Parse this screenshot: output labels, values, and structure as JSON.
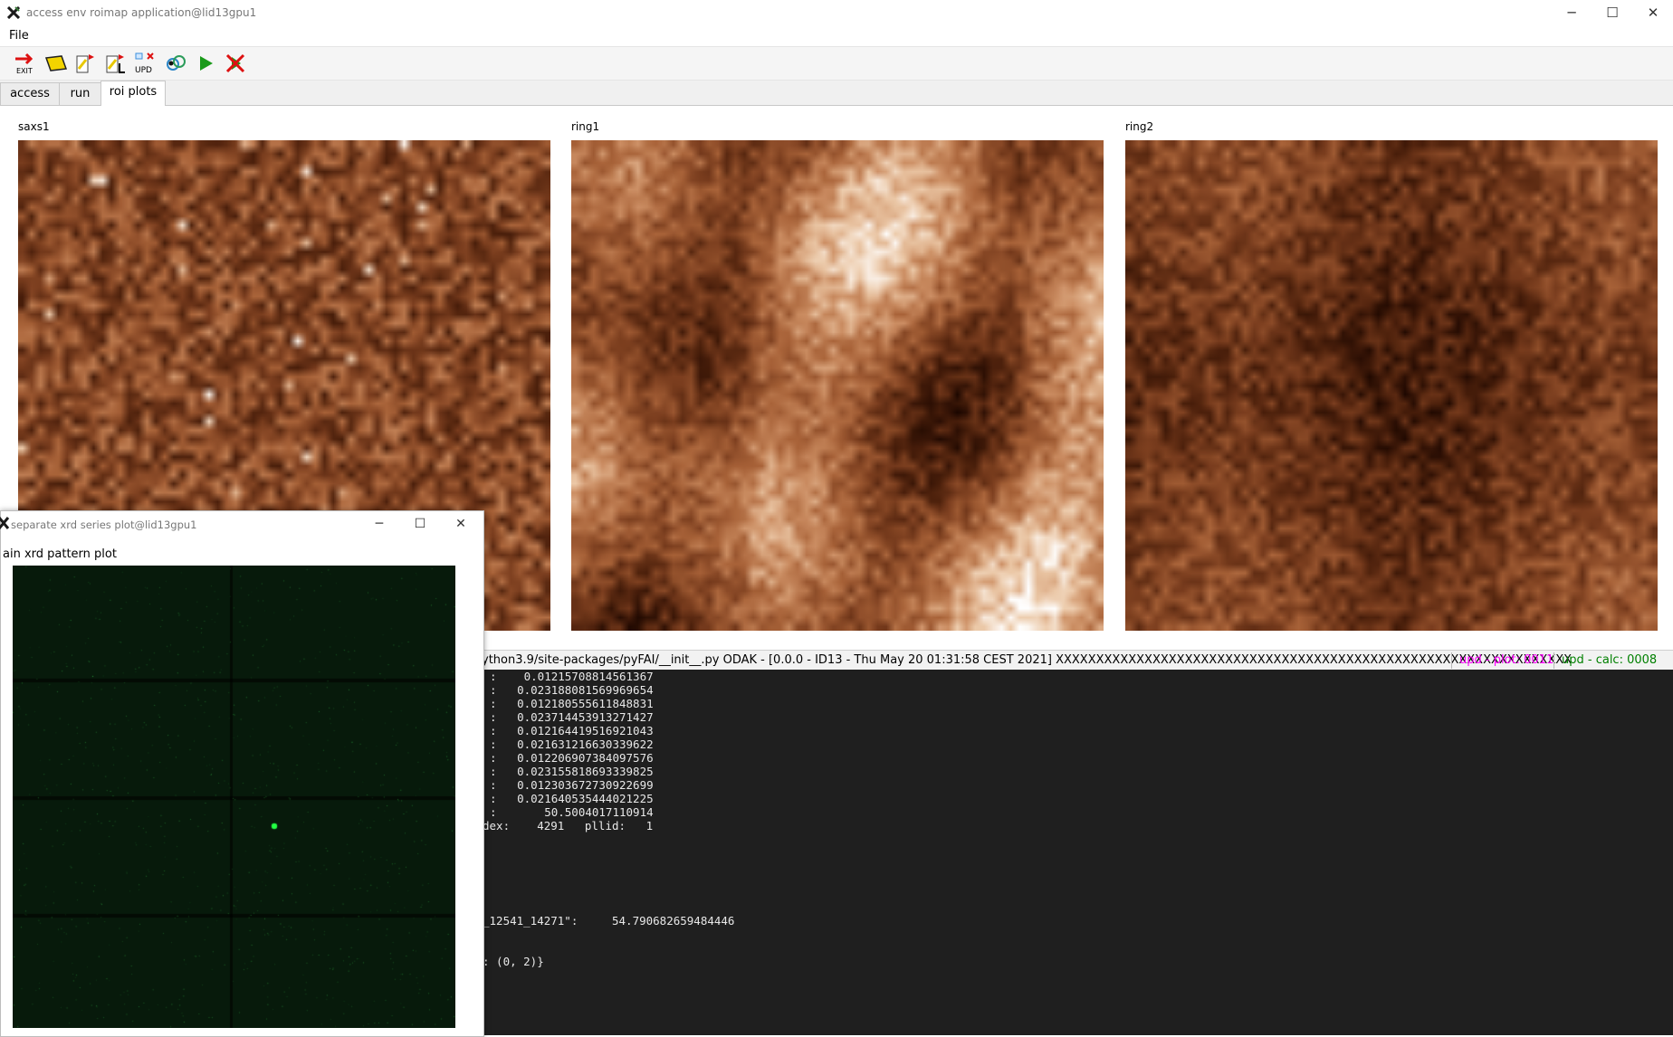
{
  "window": {
    "title": "access env roimap application@lid13gpu1",
    "app_icon": "x-app-icon",
    "minimize": "─",
    "maximize": "☐",
    "close": "✕"
  },
  "menu": {
    "items": [
      "File"
    ]
  },
  "toolbar": {
    "buttons": [
      {
        "name": "exit-icon",
        "label": "EXIT"
      },
      {
        "name": "open-folder-icon",
        "label": ""
      },
      {
        "name": "load-r-icon",
        "label": ""
      },
      {
        "name": "load-l-icon",
        "label": ""
      },
      {
        "name": "update-icon",
        "label": "UPD"
      },
      {
        "name": "refresh-icon",
        "label": ""
      },
      {
        "name": "run-icon",
        "label": ""
      },
      {
        "name": "stop-icon",
        "label": ""
      }
    ]
  },
  "tabs": [
    {
      "label": "access",
      "active": false
    },
    {
      "label": "run",
      "active": false
    },
    {
      "label": "roi plots",
      "active": true
    }
  ],
  "plots": [
    {
      "label": "saxs1"
    },
    {
      "label": "ring1"
    },
    {
      "label": "ring2"
    }
  ],
  "statusbar": {
    "message": "ython3.9/site-packages/pyFAI/__init__.py  ODAK - [0.0.0 - ID13 - Thu May 20 01:31:58 CEST 2021] XXXXXXXXXXXXXXXXXXXXXXXXXXXXXXXXXXXXXXXXXXXXXXXXXXXXXXXXXXXXXXXX",
    "plot_status": "upd - plot: 0011",
    "calc_status": "upd - calc: 0008"
  },
  "console": {
    "lines": [
      ":    0.01215708814561367",
      ":   0.023188081569969654",
      ":   0.012180555611848831",
      ":   0.023714453913271427",
      ":   0.012164419516921043",
      ":   0.021631216630339622",
      ":   0.012206907384097576",
      ":   0.023155818693339825",
      ":   0.012303672730922699",
      ":   0.021640535444021225",
      ":       50.5004017110914",
      "dex:    4291   pllid:   1",
      "",
      "",
      "",
      "",
      "",
      "_12541_14271\":     54.790682659484446",
      "",
      "",
      ": (0, 2)}"
    ]
  },
  "overlay": {
    "title": "separate xrd series plot@lid13gpu1",
    "plot_label": "ain xrd pattern plot",
    "minimize": "─",
    "maximize": "☐",
    "close": "✕"
  },
  "colors": {
    "roi_colormap": [
      "#1a0600",
      "#4a1f0b",
      "#7a3d1e",
      "#a86238",
      "#cc8e63",
      "#ecc9a8",
      "#ffffff"
    ],
    "xrd_background": "#071a0b",
    "xrd_spot": "#22ff44",
    "status_plot": "#ff00ff",
    "status_calc": "#008000",
    "console_bg": "#1f1f1f"
  }
}
